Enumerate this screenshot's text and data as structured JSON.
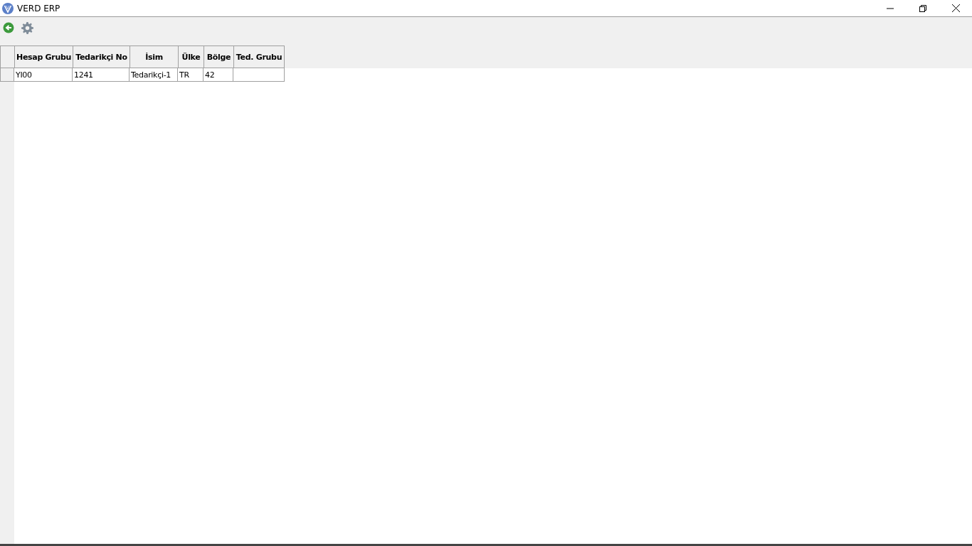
{
  "window": {
    "title": "VERD ERP"
  },
  "table": {
    "columns": [
      "Hesap Grubu",
      "Tedarikçi No",
      "İsim",
      "Ülke",
      "Bölge",
      "Ted. Grubu"
    ],
    "rows": [
      {
        "cells": [
          "YI00",
          "1241",
          "Tedarikçi-1",
          "TR",
          "42"
        ]
      }
    ]
  }
}
